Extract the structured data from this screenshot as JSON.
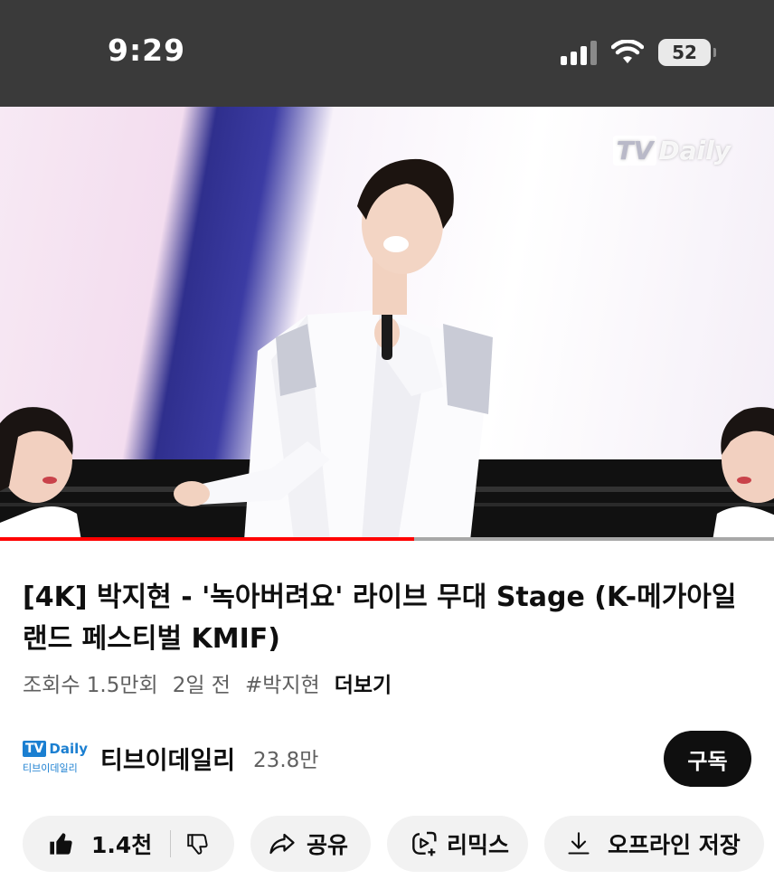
{
  "status_bar": {
    "time": "9:29",
    "battery_percent": "52",
    "signal_bars_active": 3,
    "signal_bars_total": 4,
    "icons": [
      "cellular-signal-icon",
      "wifi-icon",
      "battery-icon"
    ]
  },
  "video": {
    "watermark_brand": "Daily",
    "playback_progress": 0.535,
    "colors": {
      "progress": "#ff0000",
      "track": "#a8a8a8"
    }
  },
  "details": {
    "title": "[4K] 박지현 - '녹아버려요' 라이브 무대 Stage (K-메가아일랜드 페스티벌 KMIF)",
    "views": "조회수 1.5만회",
    "age": "2일 전",
    "hashtag": "#박지현",
    "more_label": "더보기"
  },
  "channel": {
    "logo_tv": "TV",
    "logo_brand": "Daily",
    "logo_sub": "티브이데일리",
    "name": "티브이데일리",
    "subscribers": "23.8만",
    "subscribe_label": "구독"
  },
  "actions": {
    "like_count": "1.4천",
    "share_label": "공유",
    "remix_label": "리믹스",
    "offline_label": "오프라인 저장",
    "icons": [
      "thumbs-up-icon",
      "thumbs-down-icon",
      "share-icon",
      "remix-icon",
      "download-icon"
    ]
  }
}
